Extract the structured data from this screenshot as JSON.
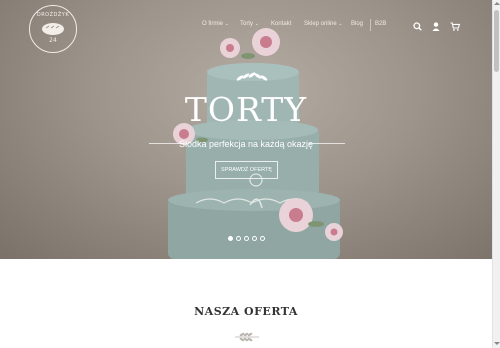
{
  "brand": {
    "logo_text": "DROŻDŻYK",
    "logo_sub": "24"
  },
  "nav": {
    "items": [
      {
        "label": "O firmie",
        "has_dropdown": true
      },
      {
        "label": "Torty",
        "has_dropdown": true
      },
      {
        "label": "Kontakt",
        "has_dropdown": false
      },
      {
        "label": "Sklep online",
        "has_dropdown": true
      },
      {
        "label": "Blog",
        "has_dropdown": false
      },
      {
        "label": "B2B",
        "has_dropdown": false
      }
    ],
    "chevron": "⌄",
    "icons": [
      "search-icon",
      "user-icon",
      "cart-icon"
    ]
  },
  "hero": {
    "title": "TORTY",
    "subtitle": "Słodka perfekcja na każdą okazję",
    "button": "SPRAWDŹ OFERTĘ",
    "slides": 5,
    "active_slide": 1
  },
  "section": {
    "title": "NASZA OFERTA"
  },
  "colors": {
    "accent": "#ffffff",
    "heading": "#333333",
    "cake": "#9fb6b3",
    "rose": "#c97c8d"
  }
}
